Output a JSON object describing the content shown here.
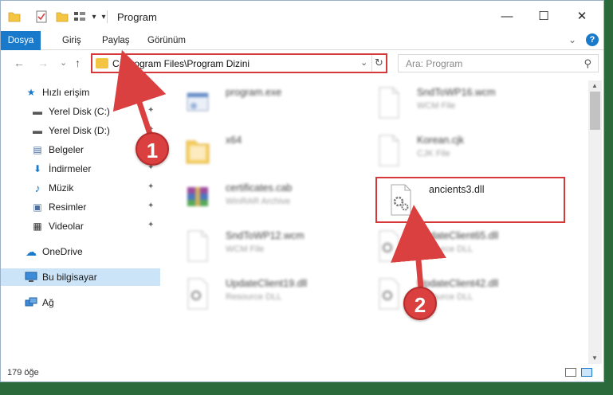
{
  "window": {
    "title": "Program"
  },
  "titlebar_buttons": {
    "minimize": "—",
    "maximize": "☐",
    "close": "✕"
  },
  "ribbon": {
    "tabs": [
      "Dosya",
      "Giriş",
      "Paylaş",
      "Görünüm"
    ],
    "expand": "⌄",
    "help": "?"
  },
  "nav": {
    "back": "←",
    "forward": "→",
    "recent": "⌄",
    "up": "↑",
    "address": "C:\\Program Files\\Program Dizini",
    "dropdown": "⌄",
    "refresh": "↻",
    "search_placeholder": "Ara: Program",
    "search_icon": "⚲"
  },
  "sidebar": {
    "items": [
      {
        "label": "Hızlı erişim",
        "icon": "star-icon",
        "glyph": "★",
        "pinned": false
      },
      {
        "label": "Yerel Disk (C:)",
        "icon": "drive-icon",
        "glyph": "▬",
        "pinned": true
      },
      {
        "label": "Yerel Disk (D:)",
        "icon": "drive-icon",
        "glyph": "▬",
        "pinned": true
      },
      {
        "label": "Belgeler",
        "icon": "documents-icon",
        "glyph": "▤",
        "pinned": true
      },
      {
        "label": "İndirmeler",
        "icon": "download-icon",
        "glyph": "⬇",
        "pinned": true
      },
      {
        "label": "Müzik",
        "icon": "music-icon",
        "glyph": "♪",
        "pinned": true
      },
      {
        "label": "Resimler",
        "icon": "pictures-icon",
        "glyph": "▣",
        "pinned": true
      },
      {
        "label": "Videolar",
        "icon": "video-icon",
        "glyph": "▦",
        "pinned": true
      },
      {
        "label": "OneDrive",
        "icon": "cloud-icon",
        "glyph": "☁",
        "pinned": false
      },
      {
        "label": "Bu bilgisayar",
        "icon": "computer-icon",
        "glyph": "▭",
        "pinned": false
      },
      {
        "label": "Ağ",
        "icon": "network-icon",
        "glyph": "⧉",
        "pinned": false
      }
    ],
    "pin_glyph": "📌"
  },
  "files": [
    {
      "name": "program.exe",
      "type": "",
      "icon": "exe-icon"
    },
    {
      "name": "SndToWP16.wcm",
      "type": "WCM File",
      "icon": "file-icon"
    },
    {
      "name": "x64",
      "type": "",
      "icon": "folder-icon"
    },
    {
      "name": "Korean.cjk",
      "type": "CJK File",
      "icon": "file-icon"
    },
    {
      "name": "certificates.cab",
      "type": "WinRAR Archive",
      "icon": "archive-icon"
    },
    {
      "name": "ancients3.dll",
      "type": "",
      "icon": "dll-icon"
    },
    {
      "name": "SndToWP12.wcm",
      "type": "WCM File",
      "icon": "file-icon"
    },
    {
      "name": "UpdateClient65.dll",
      "type": "Resource DLL",
      "icon": "dll-icon"
    },
    {
      "name": "UpdateClient19.dll",
      "type": "Resource DLL",
      "icon": "dll-icon"
    },
    {
      "name": "UpdateClient42.dll",
      "type": "Resource DLL",
      "icon": "dll-icon"
    }
  ],
  "status": {
    "count": "179 öğe"
  },
  "annotations": {
    "step1": "1",
    "step2": "2",
    "color": "#d6383a"
  },
  "colors": {
    "accent": "#1979ca",
    "highlight": "#d6383a",
    "selected": "#cce4f7"
  }
}
